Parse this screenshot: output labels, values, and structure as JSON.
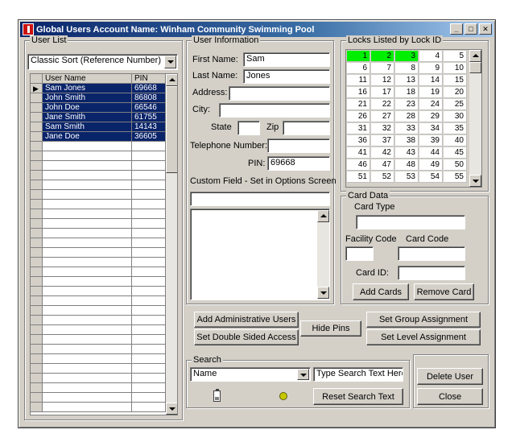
{
  "window": {
    "title": "Global Users Account Name: Winham Community Swimming Pool",
    "minimize": "_",
    "maximize": "□",
    "close": "✕"
  },
  "user_list": {
    "group_title": "User List",
    "sort_value": "Classic Sort (Reference Number)",
    "columns": [
      "User Name",
      "PIN"
    ],
    "rows": [
      {
        "name": "Sam Jones",
        "pin": "69668"
      },
      {
        "name": "John Smith",
        "pin": "86808"
      },
      {
        "name": "John Doe",
        "pin": "66546"
      },
      {
        "name": "Jane Smith",
        "pin": "61755"
      },
      {
        "name": "Sam Smith",
        "pin": "14143"
      },
      {
        "name": "Jane Doe",
        "pin": "36605"
      }
    ],
    "selected_indicator": "▶"
  },
  "user_info": {
    "group_title": "User Information",
    "first_name_label": "First Name:",
    "first_name_value": "Sam",
    "last_name_label": "Last Name:",
    "last_name_value": "Jones",
    "address_label": "Address:",
    "address_value": "",
    "city_label": "City:",
    "city_value": "",
    "state_label": "State",
    "state_value": "",
    "zip_label": "Zip",
    "zip_value": "",
    "telephone_label": "Telephone Number:",
    "telephone_value": "",
    "pin_label": "PIN:",
    "pin_value": "69668",
    "custom_field_label": "Custom Field - Set in Options Screen",
    "custom_field_value": "",
    "notes_value": ""
  },
  "locks": {
    "group_title": "Locks Listed by Lock ID",
    "ids": [
      "1",
      "2",
      "3",
      "4",
      "5",
      "6",
      "7",
      "8",
      "9",
      "10",
      "11",
      "12",
      "13",
      "14",
      "15",
      "16",
      "17",
      "18",
      "19",
      "20",
      "21",
      "22",
      "23",
      "24",
      "25",
      "26",
      "27",
      "28",
      "29",
      "30",
      "31",
      "32",
      "33",
      "34",
      "35",
      "36",
      "37",
      "38",
      "39",
      "40",
      "41",
      "42",
      "43",
      "44",
      "45",
      "46",
      "47",
      "48",
      "49",
      "50",
      "51",
      "52",
      "53",
      "54",
      "55"
    ],
    "highlighted": [
      "1",
      "2",
      "3"
    ],
    "highlight_color": "#00ee00"
  },
  "card_data": {
    "group_title": "Card Data",
    "card_type_label": "Card Type",
    "card_type_value": "",
    "facility_code_label": "Facility Code",
    "facility_code_value": "",
    "card_code_label": "Card Code",
    "card_code_value": "",
    "card_id_label": "Card ID:",
    "card_id_value": "",
    "add_cards_button": "Add Cards",
    "remove_card_button": "Remove Card"
  },
  "actions": {
    "add_admin_users": "Add Administrative Users",
    "set_double_sided": "Set Double Sided Access",
    "hide_pins": "Hide Pins",
    "set_group_assignment": "Set Group Assignment",
    "set_level_assignment": "Set Level Assignment"
  },
  "search": {
    "group_title": "Search",
    "field_value": "Name",
    "search_text": "Type Search Text Here",
    "reset_button": "Reset Search Text"
  },
  "bottom_buttons": {
    "delete_user": "Delete User",
    "close": "Close"
  },
  "colors": {
    "window_bg": "#d4d0c8",
    "selection": "#0a246a",
    "title_gradient_start": "#0a246a"
  }
}
